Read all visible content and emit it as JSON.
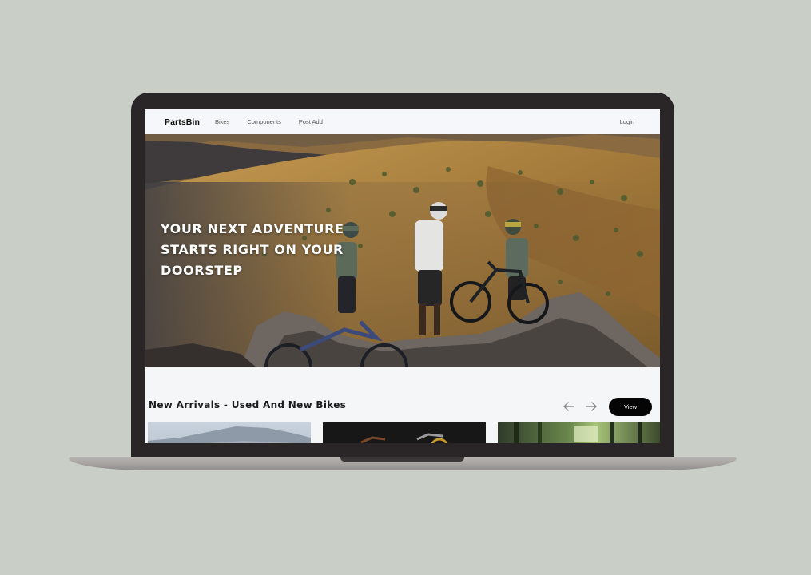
{
  "navbar": {
    "brand": "PartsBin",
    "links": [
      "Bikes",
      "Components",
      "Post Add"
    ],
    "login": "Login"
  },
  "hero": {
    "heading": "YOUR NEXT ADVENTURE STARTS RIGHT ON YOUR DOORSTEP"
  },
  "arrivals": {
    "title": "New Arrivals - Used And New Bikes",
    "view_label": "View",
    "prev_icon": "arrow-left-icon",
    "next_icon": "arrow-right-icon"
  },
  "colors": {
    "background": "#c9cec7",
    "laptop_frame": "#2a2527",
    "view_button": "#050505",
    "navbar": "#f6f7fa"
  }
}
